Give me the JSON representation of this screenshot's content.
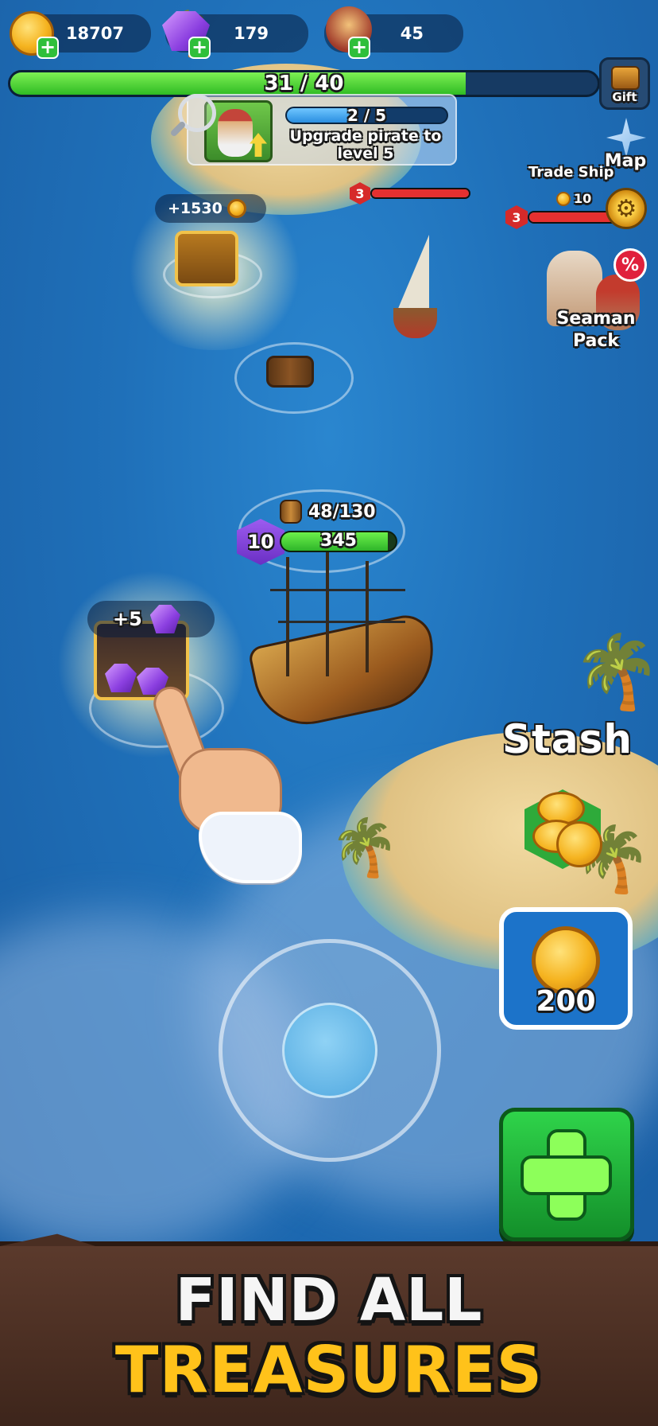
{
  "hud": {
    "coins": "18707",
    "gems": "179",
    "crew": "45",
    "progress_text": "31 / 40",
    "progress_fraction": 0.775,
    "gift_label": "Gift",
    "map_label": "Map"
  },
  "quest": {
    "progress_text": "2 / 5",
    "progress_fraction": 0.4,
    "description": "Upgrade pirate to level 5"
  },
  "enemies": {
    "trade_ship_label": "Trade Ship",
    "trade_ship_level": "3",
    "trade_ship_reward": "10",
    "hidden_ship_level": "3",
    "hidden_ship_reward": "10"
  },
  "seaman_pack": {
    "label": "Seaman Pack",
    "discount_icon": "%"
  },
  "treasures": {
    "coin_reward": "+1530",
    "gem_reward": "+5"
  },
  "player_ship": {
    "level": "10",
    "cargo": "48/130",
    "hp": "345",
    "hp_fraction": 0.93
  },
  "stash": {
    "label": "Stash",
    "coin_button_value": "200"
  },
  "banner": {
    "line1": "FIND ALL",
    "line2": "TREASURES"
  },
  "colors": {
    "ocean": "#1f70b9",
    "progress_green": "#3fd13a",
    "hp_red": "#e53030",
    "banner_brown": "#4a2e22",
    "title_gold": "#ffc21a"
  }
}
